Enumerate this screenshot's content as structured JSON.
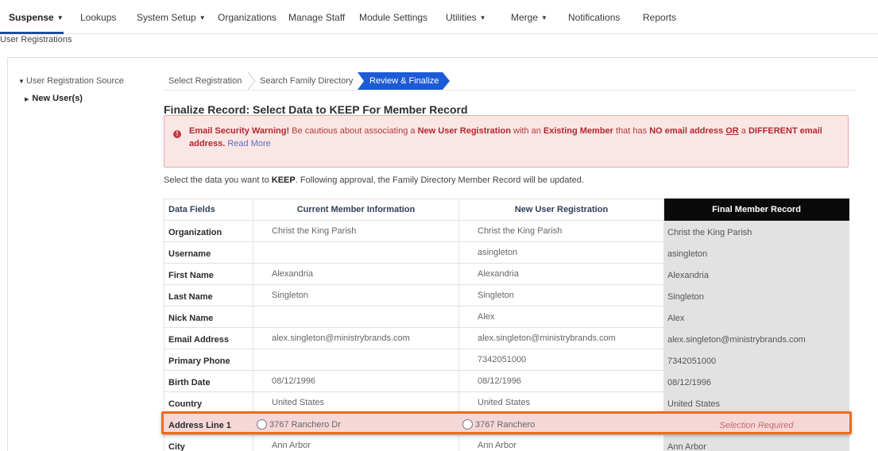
{
  "nav": {
    "items": [
      {
        "label": "Suspense",
        "dropdown": true
      },
      {
        "label": "Lookups",
        "dropdown": false
      },
      {
        "label": "System Setup",
        "dropdown": true
      },
      {
        "label": "Organizations",
        "dropdown": false
      },
      {
        "label": "Manage Staff",
        "dropdown": false
      },
      {
        "label": "Module Settings",
        "dropdown": false
      },
      {
        "label": "Utilities",
        "dropdown": true
      },
      {
        "label": "Merge",
        "dropdown": true
      },
      {
        "label": "Notifications",
        "dropdown": false
      },
      {
        "label": "Reports",
        "dropdown": false
      }
    ],
    "caret": "▼"
  },
  "breadcrumb": "User Registrations",
  "tree": {
    "root": "User Registration Source",
    "child": "New User(s)"
  },
  "steps": [
    "Select Registration",
    "Search Family Directory",
    "Review & Finalize"
  ],
  "page_title": "Finalize Record: Select Data to KEEP For Member Record",
  "warning": {
    "icon": "!",
    "title": "Email Security Warning!",
    "t1": " Be cautious about associating a ",
    "b1": "New User Registration",
    "t2": " with an ",
    "b2": "Existing Member",
    "t3": " that has ",
    "b3": "NO email address",
    "t4": " ",
    "or": "OR",
    "t5": " a ",
    "b4": "DIFFERENT email address.",
    "link": "Read More"
  },
  "instructions": {
    "pre": "Select the data you want to ",
    "keep": "KEEP",
    "post": ". Following approval, the Family Directory Member Record will be updated."
  },
  "table": {
    "headers": [
      "Data Fields",
      "Current Member Information",
      "New User Registration",
      "Final Member Record"
    ],
    "rows": [
      {
        "field": "Organization",
        "current": "Christ the King Parish",
        "new": "Christ the King Parish",
        "final": "Christ the King Parish"
      },
      {
        "field": "Username",
        "current": "",
        "new": "asingleton",
        "final": "asingleton"
      },
      {
        "field": "First Name",
        "current": "Alexandria",
        "new": "Alexandria",
        "final": "Alexandria"
      },
      {
        "field": "Last Name",
        "current": "Singleton",
        "new": "Singleton",
        "final": "Singleton"
      },
      {
        "field": "Nick Name",
        "current": "",
        "new": "Alex",
        "final": "Alex"
      },
      {
        "field": "Email Address",
        "current": "alex.singleton@ministrybrands.com",
        "new": "alex.singleton@ministrybrands.com",
        "final": "alex.singleton@ministrybrands.com"
      },
      {
        "field": "Primary Phone",
        "current": "",
        "new": "7342051000",
        "final": "7342051000"
      },
      {
        "field": "Birth Date",
        "current": "08/12/1996",
        "new": "08/12/1996",
        "final": "08/12/1996"
      },
      {
        "field": "Country",
        "current": "United States",
        "new": "United States",
        "final": "United States"
      },
      {
        "field": "Address Line 1",
        "current": "3767 Ranchero Dr",
        "new": "3767 Ranchero",
        "final": "Selection Required",
        "selection": true
      },
      {
        "field": "City",
        "current": "Ann Arbor",
        "new": "Ann Arbor",
        "final": "Ann Arbor"
      }
    ]
  },
  "colors": {
    "accent": "#1f4e9a",
    "active_step": "#1c5bd6",
    "warning_bg": "#fbe6e6",
    "warning_text": "#b2282c",
    "highlight": "#ef6a1e",
    "final_header": "#0a0a0a"
  }
}
